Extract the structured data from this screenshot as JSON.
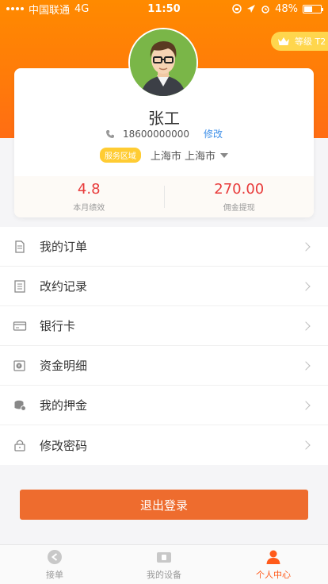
{
  "status_bar": {
    "carrier": "中国联通",
    "network": "4G",
    "time": "11:50",
    "battery": "48%",
    "battery_level": 0.48
  },
  "level_badge": {
    "label": "等级 T2"
  },
  "profile": {
    "name": "张工",
    "phone": "18600000000",
    "edit_label": "修改",
    "area_tag": "服务区域",
    "area_value": "上海市 上海市"
  },
  "stats": [
    {
      "value": "4.8",
      "label": "本月绩效"
    },
    {
      "value": "270.00",
      "label": "佣金提现"
    }
  ],
  "menu": [
    {
      "label": "我的订单",
      "icon": "document-icon"
    },
    {
      "label": "改约记录",
      "icon": "record-icon"
    },
    {
      "label": "银行卡",
      "icon": "bank-card-icon"
    },
    {
      "label": "资金明细",
      "icon": "money-icon"
    },
    {
      "label": "我的押金",
      "icon": "deposit-icon"
    },
    {
      "label": "修改密码",
      "icon": "lock-icon"
    }
  ],
  "logout_label": "退出登录",
  "tabs": [
    {
      "label": "接单",
      "icon": "order-icon",
      "active": false
    },
    {
      "label": "我的设备",
      "icon": "device-icon",
      "active": false
    },
    {
      "label": "个人中心",
      "icon": "person-icon",
      "active": true
    }
  ],
  "colors": {
    "header": "#ff7a0a",
    "accent": "#ee6c2e",
    "stat_value": "#e83b3b",
    "link": "#3d8fe8",
    "tag": "#ffcc33"
  }
}
